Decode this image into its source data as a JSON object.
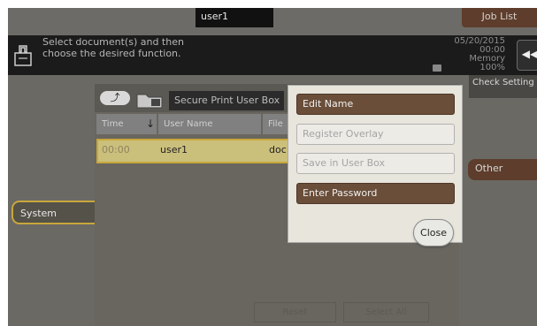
{
  "header": {
    "user": "user1",
    "job_list": "Job List"
  },
  "message": {
    "text": "Select document(s) and then\nchoose the desired function.",
    "status": "05/20/2015\n00:00\nMemory\n100%"
  },
  "right": {
    "check_settings": "Check Setting",
    "other": "Other"
  },
  "left": {
    "system": "System"
  },
  "box": {
    "title": "Secure Print User Box",
    "columns": [
      "Time",
      "User Name",
      "File"
    ],
    "row": {
      "time": "00:00",
      "user": "user1",
      "file": "doc"
    }
  },
  "footer": {
    "reset": "Reset",
    "select_all": "Select All"
  },
  "modal": {
    "items": [
      {
        "label": "Edit Name",
        "state": "active"
      },
      {
        "label": "Register Overlay",
        "state": "disabled"
      },
      {
        "label": "Save in User Box",
        "state": "disabled"
      },
      {
        "label": "Enter Password",
        "state": "active"
      }
    ],
    "close": "Close"
  },
  "colors": {
    "accent": "#6a4e39",
    "highlight": "#c9a73b",
    "job_tab": "#5e3d2c"
  }
}
